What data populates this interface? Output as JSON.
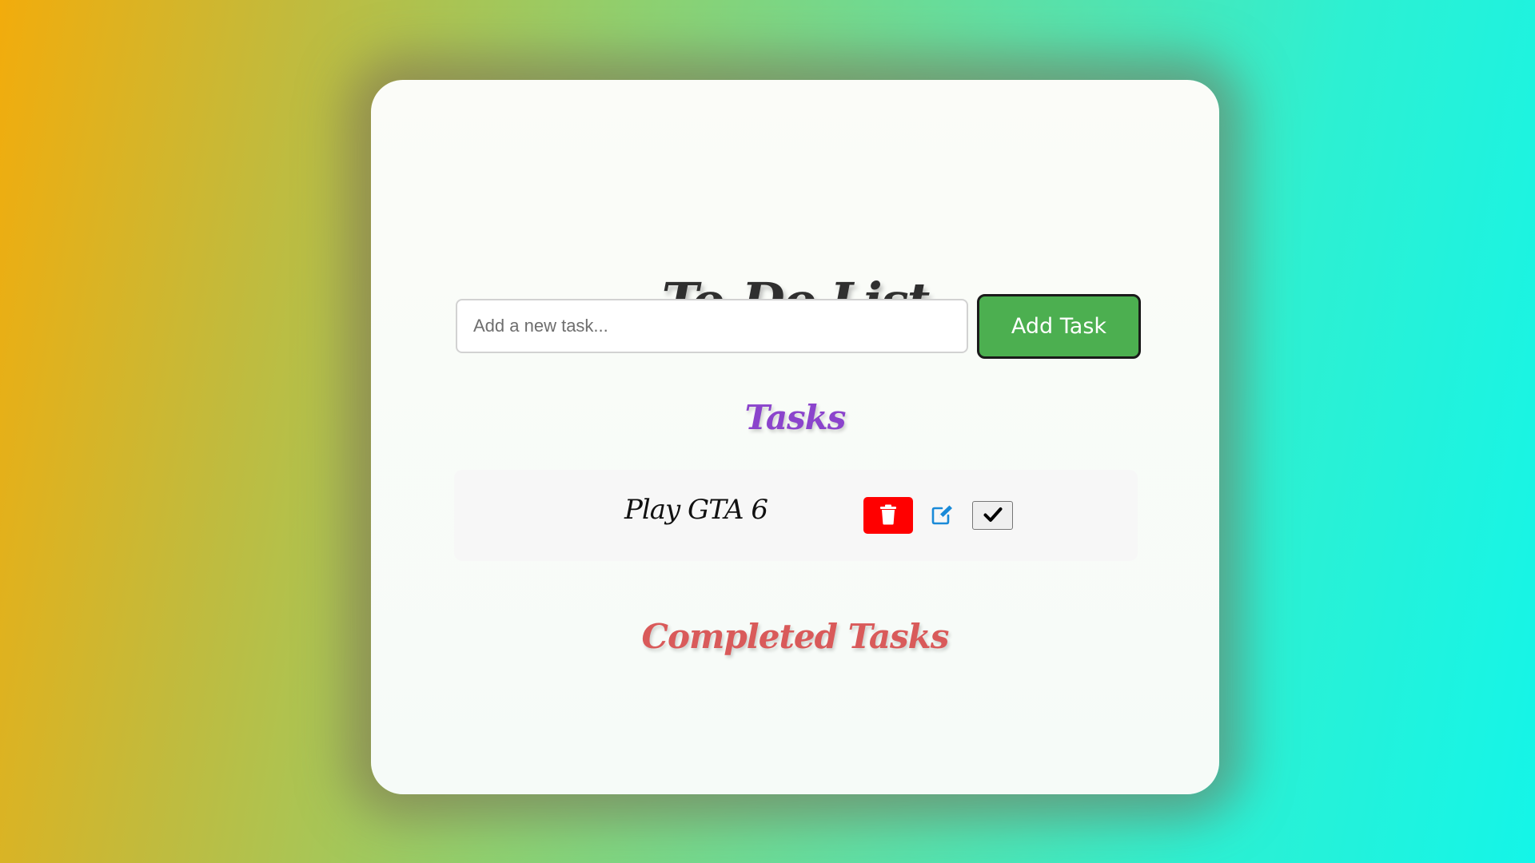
{
  "app": {
    "title": "To-Do List"
  },
  "input": {
    "placeholder": "Add a new task...",
    "value": ""
  },
  "add_button": {
    "label": "Add Task"
  },
  "tasks_section": {
    "heading": "Tasks",
    "items": [
      {
        "text": "Play GTA 6",
        "delete_icon": "trash-icon",
        "edit_icon": "edit-icon",
        "complete_icon": "check-icon"
      }
    ]
  },
  "completed_section": {
    "heading": "Completed Tasks",
    "items": []
  },
  "colors": {
    "add_button": "#4caf50",
    "delete_button": "#ff0000",
    "edit_icon": "#1a8ad8",
    "tasks_heading": "#8b44cc",
    "completed_heading": "#d95a5a"
  }
}
